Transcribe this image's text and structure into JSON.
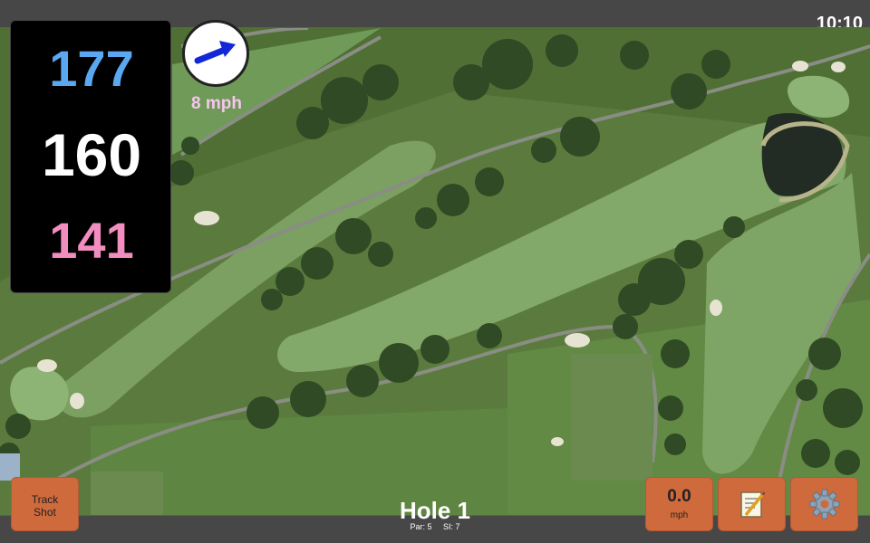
{
  "status": {
    "time": "10:10"
  },
  "yardages": {
    "back": "177",
    "center": "160",
    "front": "141"
  },
  "wind": {
    "speed_label": "8 mph",
    "value": "0.0",
    "unit": "mph",
    "direction_icon": "wind-arrow-icon"
  },
  "buttons": {
    "track_shot_line1": "Track",
    "track_shot_line2": "Shot",
    "notes_icon": "notes-icon",
    "settings_icon": "gear-icon"
  },
  "hole": {
    "title": "Hole 1",
    "par": "Par: 5",
    "si": "SI: 7"
  },
  "colors": {
    "back": "#5aa8f0",
    "center": "#ffffff",
    "front": "#f28dc0",
    "button": "#cf6a3c",
    "wind_label": "#f6c6ee"
  }
}
